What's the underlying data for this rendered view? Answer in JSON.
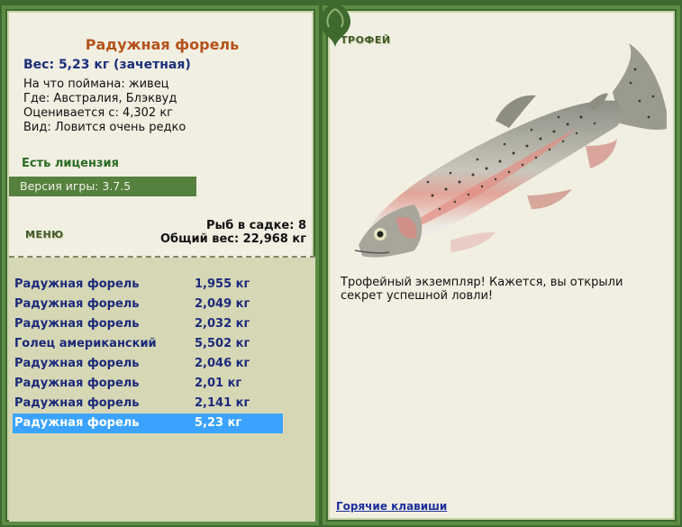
{
  "catch": {
    "fish_name": "Радужная форель",
    "weight_line": "Вес: 5,23 кг (зачетная)",
    "bait": "На что поймана: живец",
    "place": "Где: Австралия, Блэквуд",
    "valued_from": "Оценивается с: 4,302 кг",
    "rarity": "Вид: Ловится очень редко"
  },
  "license": "Есть лицензия",
  "version": "Версия игры: 3.7.5",
  "menu_label": "МЕНЮ",
  "keepnet": {
    "count": "Рыб в садке: 8",
    "total_weight": "Общий вес: 22,968 кг"
  },
  "fish_list": [
    {
      "name": "Радужная форель",
      "weight": "1,955 кг"
    },
    {
      "name": "Радужная форель",
      "weight": "2,049 кг"
    },
    {
      "name": "Радужная форель",
      "weight": "2,032 кг"
    },
    {
      "name": "Голец американский",
      "weight": "5,502 кг"
    },
    {
      "name": "Радужная форель",
      "weight": "2,046 кг"
    },
    {
      "name": "Радужная форель",
      "weight": "2,01 кг"
    },
    {
      "name": "Радужная форель",
      "weight": "2,141 кг"
    },
    {
      "name": "Радужная форель",
      "weight": "5,23 кг"
    }
  ],
  "selected_index": 7,
  "trophy": {
    "label": "ТРОФЕЙ",
    "text": "Трофейный экземпляр! Кажется, вы открыли секрет успешной ловли!",
    "fish_image": "rainbow-trout-image"
  },
  "hotkeys": "Горячие клавиши",
  "colors": {
    "frame": "#4f7a3a",
    "panel_bg": "#f1efe2",
    "list_bg": "#d6d7b5",
    "selected_row": "#3ba3ff",
    "title": "#b5521a",
    "list_text": "#1b2a7a"
  }
}
